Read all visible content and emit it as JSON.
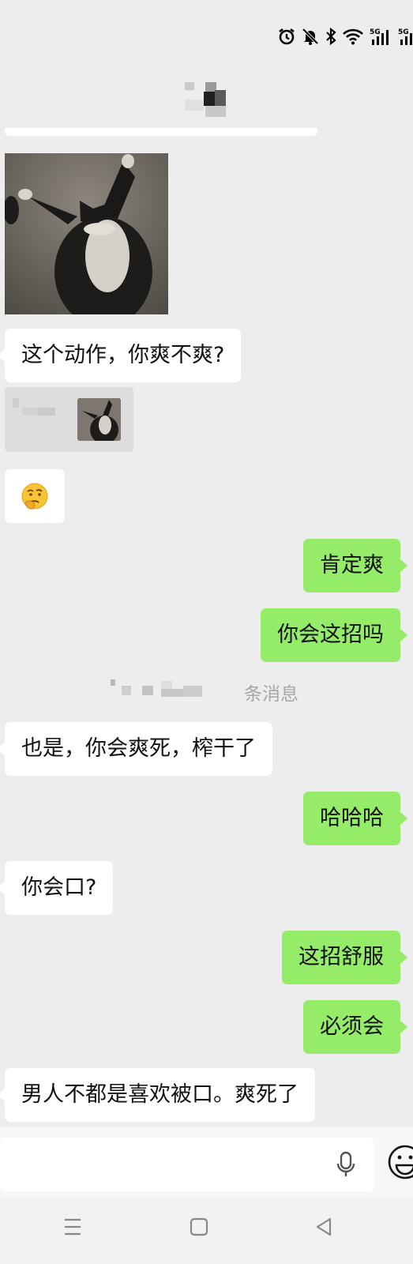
{
  "status_bar": {
    "icons": [
      "alarm-icon",
      "mute-bell-icon",
      "bluetooth-icon",
      "wifi-icon",
      "signal-5g-1-icon",
      "signal-5g-2-icon"
    ],
    "network_label_1": "5G",
    "network_label_2": "5G"
  },
  "header": {
    "contact_name_obscured": true
  },
  "messages": {
    "m1_text": "这个动作，你爽不爽?",
    "m2_text": "肯定爽",
    "m3_text": "你会这招吗",
    "divider_suffix": "条消息",
    "m4_text": "也是，你会爽死，榨干了",
    "m5_text": "哈哈哈",
    "m6_text": "你会口?",
    "m7_text": "这招舒服",
    "m8_text": "必须会",
    "m9_text": "男人不都是喜欢被口。爽死了"
  },
  "emoji_message": "🤔",
  "colors": {
    "background": "#ededed",
    "incoming_bubble": "#ffffff",
    "outgoing_bubble": "#95ec69",
    "divider_text": "#a7a7a7"
  },
  "input_bar": {
    "icons": [
      "microphone-icon",
      "emoji-icon"
    ]
  },
  "system_nav": {
    "icons": [
      "menu-icon",
      "home-icon",
      "back-icon"
    ]
  }
}
